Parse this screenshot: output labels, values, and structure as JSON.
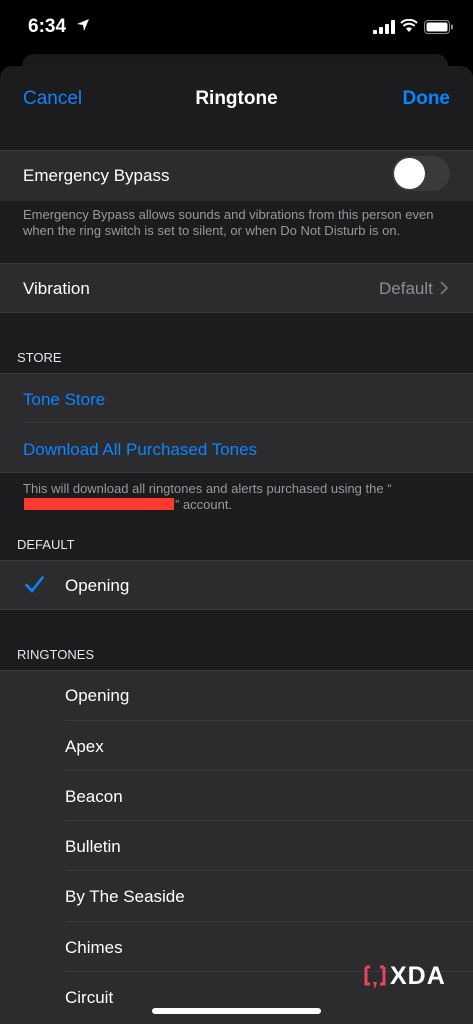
{
  "status_bar": {
    "time": "6:34"
  },
  "nav": {
    "cancel_label": "Cancel",
    "title": "Ringtone",
    "done_label": "Done"
  },
  "emergency_bypass": {
    "label": "Emergency Bypass",
    "enabled": false,
    "footer": "Emergency Bypass allows sounds and vibrations from this person even when the ring switch is set to silent, or when Do Not Disturb is on."
  },
  "vibration": {
    "label": "Vibration",
    "value": "Default"
  },
  "store": {
    "header": "STORE",
    "tone_store_label": "Tone Store",
    "download_label": "Download All Purchased Tones",
    "footer_before": "This will download all ringtones and alerts purchased using the “",
    "footer_after": "” account."
  },
  "default_section": {
    "header": "DEFAULT",
    "selected": "Opening"
  },
  "ringtones": {
    "header": "RINGTONES",
    "items": [
      "Opening",
      "Apex",
      "Beacon",
      "Bulletin",
      "By The Seaside",
      "Chimes",
      "Circuit"
    ]
  },
  "watermark": {
    "text": "XDA",
    "accent": "#e8445a"
  },
  "colors": {
    "accent": "#0a84ff",
    "redaction": "#ff3b30"
  }
}
